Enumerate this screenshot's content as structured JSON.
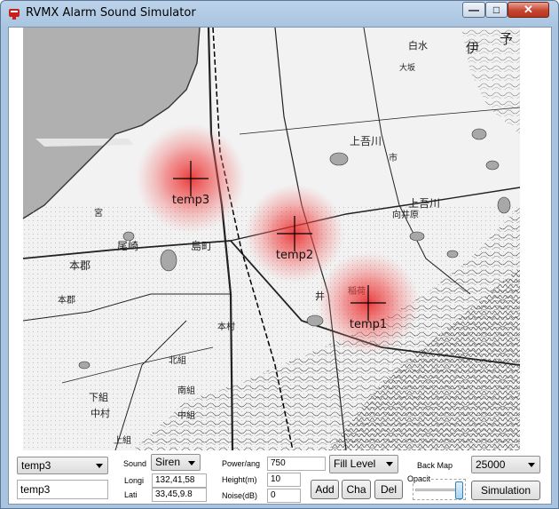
{
  "window": {
    "title": "RVMX Alarm Sound Simulator",
    "minimize_glyph": "—",
    "maximize_glyph": "□",
    "close_glyph": "✕"
  },
  "map": {
    "markers": [
      {
        "label": "temp3"
      },
      {
        "label": "temp2"
      },
      {
        "label": "temp1"
      }
    ],
    "place_labels": [
      "白水",
      "伊",
      "予",
      "上吾川",
      "市",
      "上吾川",
      "向井原",
      "大坂",
      "尾崎",
      "島町",
      "本郡",
      "下組",
      "中村",
      "上組",
      "南組",
      "北組",
      "本村",
      "宮",
      "本郡",
      "中組",
      "井",
      "稲荷"
    ],
    "heat_color": "#f04040"
  },
  "controls": {
    "source_select": "temp3",
    "name_input": "temp3",
    "sound_label": "Sound",
    "sound_select": "Siren",
    "lon_label": "Longi",
    "lon_value": "132,41,58",
    "lat_label": "Lati",
    "lat_value": "33,45,9.8",
    "power_label": "Power/ang",
    "power_value": "750",
    "height_label": "Height(m)",
    "height_value": "10",
    "noise_label": "Noise(dB)",
    "noise_value": "0",
    "fill_select": "Fill Level",
    "add_button": "Add",
    "change_button": "Cha",
    "delete_button": "Del",
    "backmap_label": "Back Map",
    "opacity_label": "Opacit",
    "opacity_value": 0.95,
    "scale_select": "25000",
    "simulation_button": "Simulation"
  }
}
